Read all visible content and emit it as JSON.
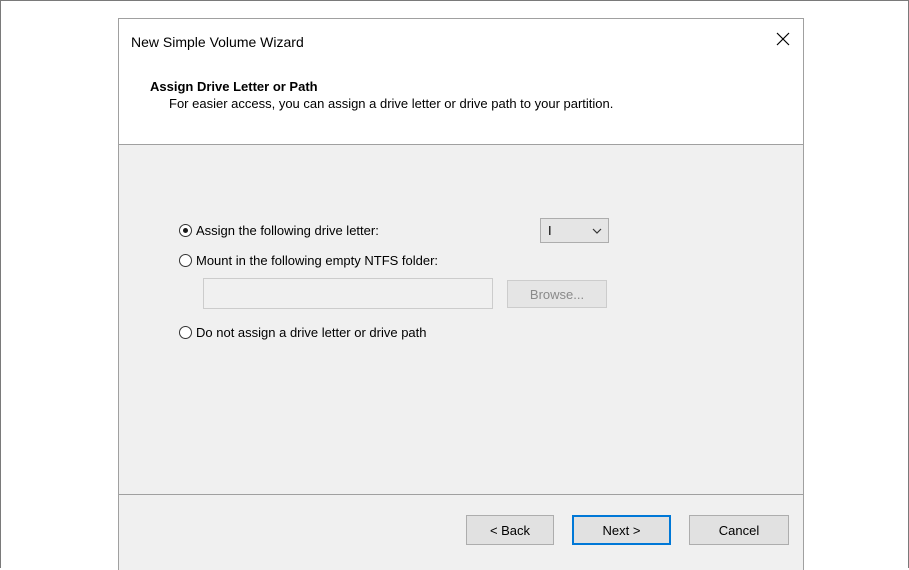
{
  "window": {
    "title": "New Simple Volume Wizard",
    "close_icon": "close-icon"
  },
  "header": {
    "title": "Assign Drive Letter or Path",
    "description": "For easier access, you can assign a drive letter or drive path to your partition."
  },
  "options": {
    "assign_letter": {
      "label": "Assign the following drive letter:",
      "checked": true
    },
    "drive_letter": {
      "value": "I"
    },
    "mount_folder": {
      "label": "Mount in the following empty NTFS folder:",
      "checked": false,
      "path_value": ""
    },
    "browse_label": "Browse...",
    "no_assign": {
      "label": "Do not assign a drive letter or drive path",
      "checked": false
    }
  },
  "buttons": {
    "back": "< Back",
    "next": "Next >",
    "cancel": "Cancel"
  },
  "colors": {
    "accent": "#0078d7",
    "panel": "#f0f0f0",
    "disabled_text": "#8a8a8a"
  }
}
